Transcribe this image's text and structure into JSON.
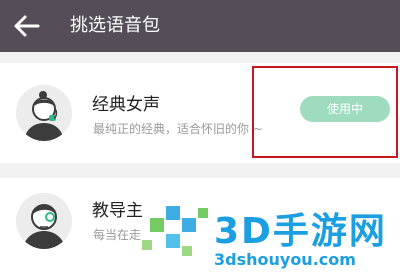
{
  "header": {
    "title": "挑选语音包",
    "back_icon": "arrow-left-icon",
    "background": "#554d57"
  },
  "voice_packs": [
    {
      "name": "经典女声",
      "description": "最纯正的经典，适合怀旧的你 ~",
      "button_label": "使用中",
      "avatar_icon": "woman-with-headset-avatar"
    },
    {
      "name": "教导主",
      "description": "每当在走",
      "avatar_icon": "man-with-glasses-avatar"
    }
  ],
  "colors": {
    "accent": "#9fdcbf",
    "highlight": "#c8161d",
    "watermark": "#1c9fe0"
  },
  "watermark": {
    "brand": "3D手游网",
    "url": "3dshouyou.com"
  }
}
